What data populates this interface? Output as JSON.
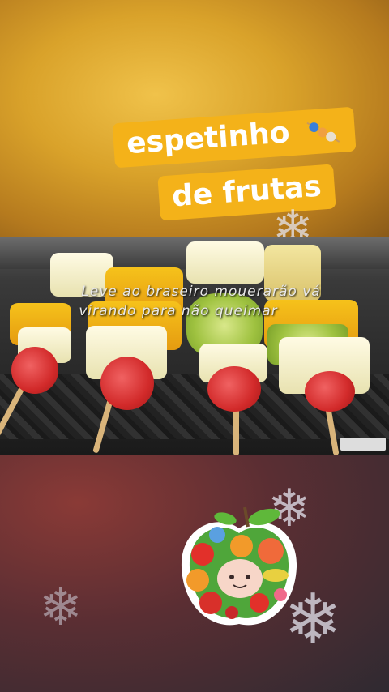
{
  "title": {
    "line1": "espetinho",
    "line2": "de frutas",
    "icon": "skewer-icon"
  },
  "caption": {
    "line1": "Leve ao braseiro mouerarão vá",
    "line2": "virando para não queimar"
  },
  "decorations": {
    "snowflake_icon": "snowflake-icon",
    "sticker_icon": "apple-fruit-sticker-icon"
  },
  "colors": {
    "title_bg": "#f4b219",
    "title_text": "#ffffff",
    "caption_text": "#e8e8e8"
  }
}
